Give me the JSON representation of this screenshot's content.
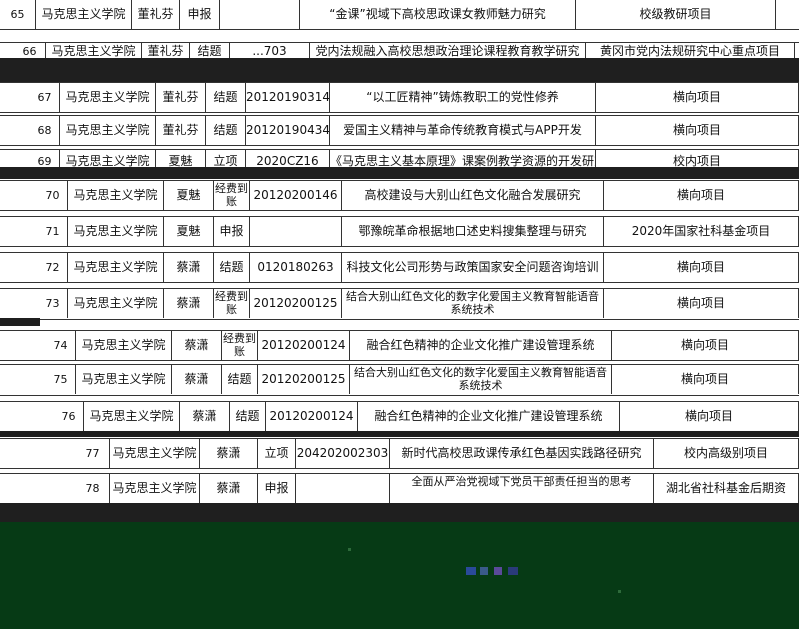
{
  "table": {
    "rows": [
      {
        "no": "65",
        "college": "马克思主义学院",
        "name": "董礼芬",
        "status": "申报",
        "code": "",
        "topic": "“金课”视域下高校思政课女教师魅力研究",
        "type": "校级教研项目"
      },
      {
        "no": "66",
        "college": "马克思主义学院",
        "name": "董礼芬",
        "status": "结题",
        "code": "...703",
        "topic": "党内法规融入高校思想政治理论课程教育教学研究",
        "type": "黄冈市党内法规研究中心重点项目"
      },
      {
        "no": "67",
        "college": "马克思主义学院",
        "name": "董礼芬",
        "status": "结题",
        "code": "20120190314",
        "topic": "“以工匠精神”铸炼教职工的党性修养",
        "type": "横向项目"
      },
      {
        "no": "68",
        "college": "马克思主义学院",
        "name": "董礼芬",
        "status": "结题",
        "code": "20120190434",
        "topic": "爱国主义精神与革命传统教育模式与APP开发",
        "type": "横向项目"
      },
      {
        "no": "69",
        "college": "马克思主义学院",
        "name": "夏魅",
        "status": "立项",
        "code": "2020CZ16",
        "topic": "《马克思主义基本原理》课案例教学资源的开发研究",
        "type": "校内项目"
      },
      {
        "no": "70",
        "college": "马克思主义学院",
        "name": "夏魅",
        "status": "经费到账",
        "code": "20120200146",
        "topic": "高校建设与大别山红色文化融合发展研究",
        "type": "横向项目"
      },
      {
        "no": "71",
        "college": "马克思主义学院",
        "name": "夏魅",
        "status": "申报",
        "code": "",
        "topic": "鄂豫皖革命根据地口述史料搜集整理与研究",
        "type": "2020年国家社科基金项目"
      },
      {
        "no": "72",
        "college": "马克思主义学院",
        "name": "蔡潇",
        "status": "结题",
        "code": "0120180263",
        "topic": "科技文化公司形势与政策国家安全问题咨询培训",
        "type": "横向项目"
      },
      {
        "no": "73",
        "college": "马克思主义学院",
        "name": "蔡潇",
        "status": "经费到账",
        "code": "20120200125",
        "topic": "结合大别山红色文化的数字化爱国主义教育智能语音系统技术",
        "type": "横向项目"
      },
      {
        "no": "74",
        "college": "马克思主义学院",
        "name": "蔡潇",
        "status": "经费到账",
        "code": "20120200124",
        "topic": "融合红色精神的企业文化推广建设管理系统",
        "type": "横向项目"
      },
      {
        "no": "75",
        "college": "马克思主义学院",
        "name": "蔡潇",
        "status": "结题",
        "code": "20120200125",
        "topic": "结合大别山红色文化的数字化爱国主义教育智能语音系统技术",
        "type": "横向项目"
      },
      {
        "no": "76",
        "college": "马克思主义学院",
        "name": "蔡潇",
        "status": "结题",
        "code": "20120200124",
        "topic": "融合红色精神的企业文化推广建设管理系统",
        "type": "横向项目"
      },
      {
        "no": "77",
        "college": "马克思主义学院",
        "name": "蔡潇",
        "status": "立项",
        "code": "204202002303",
        "topic": "新时代高校思政课传承红色基因实践路径研究",
        "type": "校内高级别项目"
      },
      {
        "no": "78",
        "college": "马克思主义学院",
        "name": "蔡潇",
        "status": "申报",
        "code": "",
        "topic": "全面从严治党视域下党员干部责任担当的思考",
        "type": "湖北省社科基金后期资"
      }
    ]
  }
}
